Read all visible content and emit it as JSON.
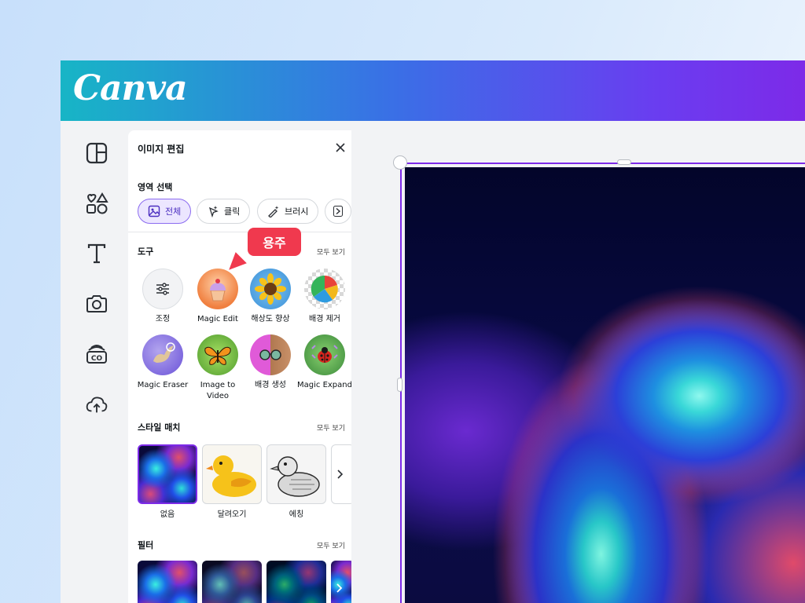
{
  "brand": {
    "logo_text": "Canva",
    "accent": "#7d2ae8",
    "gradient_start": "#17b5c6",
    "gradient_end": "#7d2ae8"
  },
  "rail": {
    "icons": [
      "layout-icon",
      "elements-icon",
      "text-icon",
      "camera-icon",
      "brand-co-icon",
      "upload-cloud-icon"
    ]
  },
  "panel": {
    "title": "이미지 편집",
    "area_select": {
      "title": "영역 선택",
      "chips": [
        {
          "label": "전체",
          "icon": "image-icon",
          "active": true
        },
        {
          "label": "클릭",
          "icon": "sparkle-cursor-icon",
          "active": false
        },
        {
          "label": "브러시",
          "icon": "magic-brush-icon",
          "active": false
        }
      ]
    },
    "tools": {
      "title": "도구",
      "see_all": "모두 보기",
      "items": [
        {
          "label": "조정"
        },
        {
          "label": "Magic Edit"
        },
        {
          "label": "해상도 향상"
        },
        {
          "label": "배경 제거"
        },
        {
          "label": "Magic Eraser"
        },
        {
          "label": "Image to Video"
        },
        {
          "label": "배경 생성"
        },
        {
          "label": "Magic Expand"
        }
      ]
    },
    "style_match": {
      "title": "스타일 매치",
      "see_all": "모두 보기",
      "items": [
        {
          "label": "없음"
        },
        {
          "label": "달려오기"
        },
        {
          "label": "에칭"
        }
      ]
    },
    "filters": {
      "title": "필터",
      "see_all": "모두 보기"
    }
  },
  "annotation": {
    "tag": "용주",
    "color": "#f0394e"
  }
}
